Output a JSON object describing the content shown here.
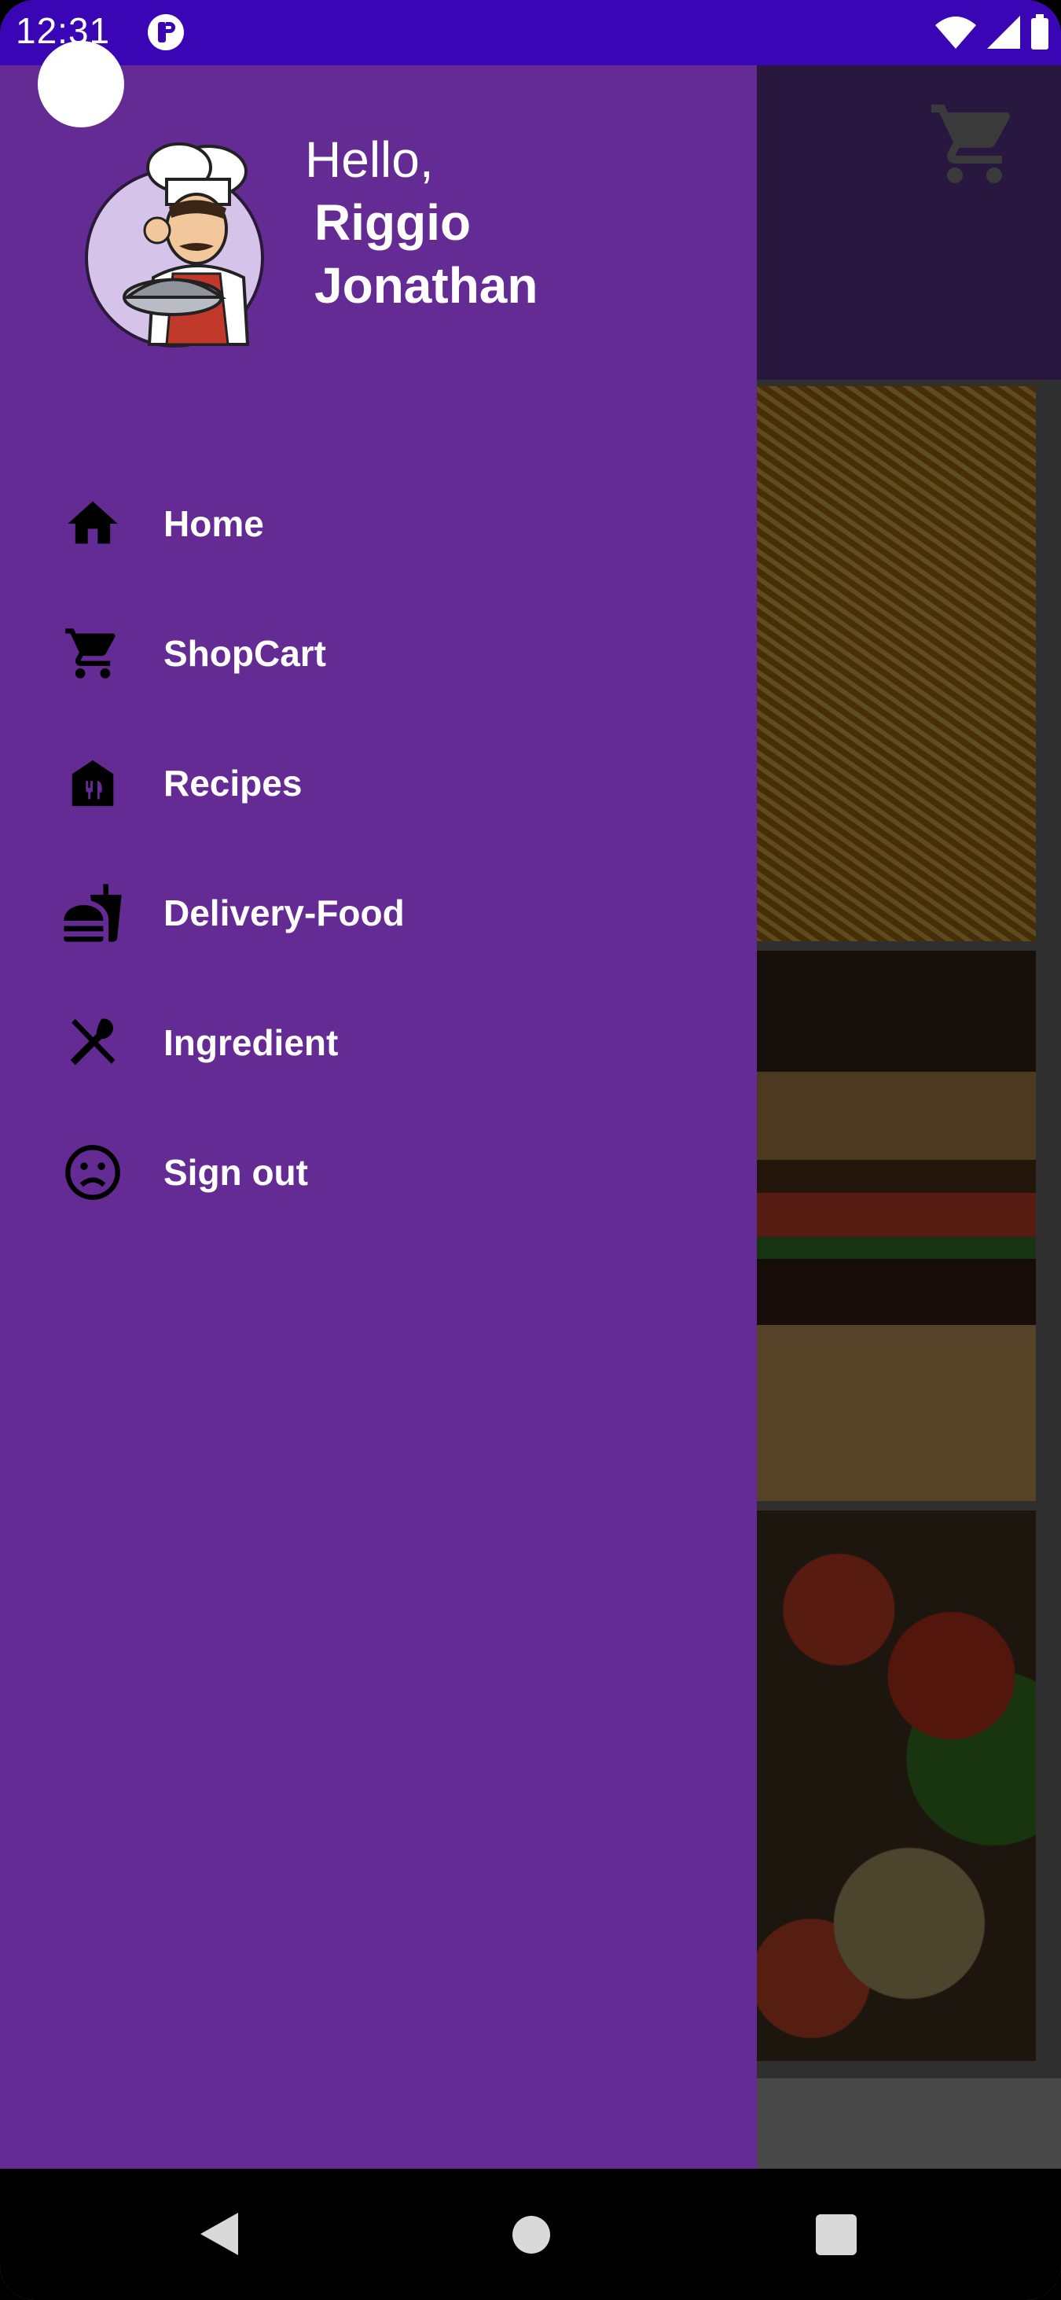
{
  "status_bar": {
    "time": "12:31"
  },
  "drawer": {
    "greeting": "Hello,",
    "user_name_first": "Riggio",
    "user_name_last": "Jonathan",
    "menu": [
      {
        "label": "Home",
        "icon": "home-icon"
      },
      {
        "label": "ShopCart",
        "icon": "cart-icon"
      },
      {
        "label": "Recipes",
        "icon": "restaurant-house-icon"
      },
      {
        "label": "Delivery-Food",
        "icon": "fastfood-icon"
      },
      {
        "label": "Ingredient",
        "icon": "spoon-knife-cross-icon"
      },
      {
        "label": "Sign out",
        "icon": "sad-face-icon"
      }
    ]
  },
  "background_app": {
    "cards": [
      "noodles",
      "burger",
      "vegetables"
    ],
    "top_icon": "cart-icon"
  },
  "colors": {
    "status_bar": "#3a05b5",
    "drawer": "#632b93",
    "app_bar": "#6a3ea5"
  }
}
